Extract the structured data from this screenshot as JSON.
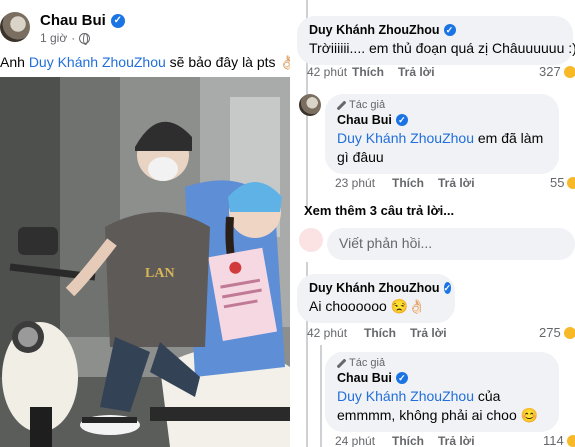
{
  "post": {
    "author": "Chau Bui",
    "time": "1 giờ",
    "text_prefix": "Anh ",
    "mention": "Duy Khánh ZhouZhou",
    "text_suffix": " sẽ bảo đây là pts 👌🏻"
  },
  "comments": [
    {
      "author": "Duy Khánh ZhouZhou",
      "text": "Trờiiiiii.... em thủ đoạn quá zị Châuuuuuu :))",
      "time": "42 phút",
      "like": "Thích",
      "reply": "Trả lời",
      "reactions": "327"
    },
    {
      "tag": "Tác giả",
      "author": "Chau Bui",
      "mention": "Duy Khánh ZhouZhou",
      "text": " em đã làm gì đâuu",
      "time": "23 phút",
      "like": "Thích",
      "reply": "Trả lời",
      "reactions": "55"
    }
  ],
  "more_replies": "Xem thêm 3 câu trả lời...",
  "reply_input": {
    "placeholder": "Viết phản hồi..."
  },
  "comments2": [
    {
      "author": "Duy Khánh ZhouZhou",
      "text": "Ai choooooo 😒👌🏻",
      "time": "42 phút",
      "like": "Thích",
      "reply": "Trả lời",
      "reactions": "275"
    },
    {
      "tag": "Tác giả",
      "author": "Chau Bui",
      "mention": "Duy Khánh ZhouZhou",
      "text": " của emmmm, không phải ai choo 😊",
      "time": "24 phút",
      "like": "Thích",
      "reply": "Trả lời",
      "reactions": "114"
    }
  ],
  "colors": {
    "link": "#216fdb",
    "verified": "#1b74e4",
    "bubble": "#f0f2f5",
    "meta": "#65676b"
  }
}
